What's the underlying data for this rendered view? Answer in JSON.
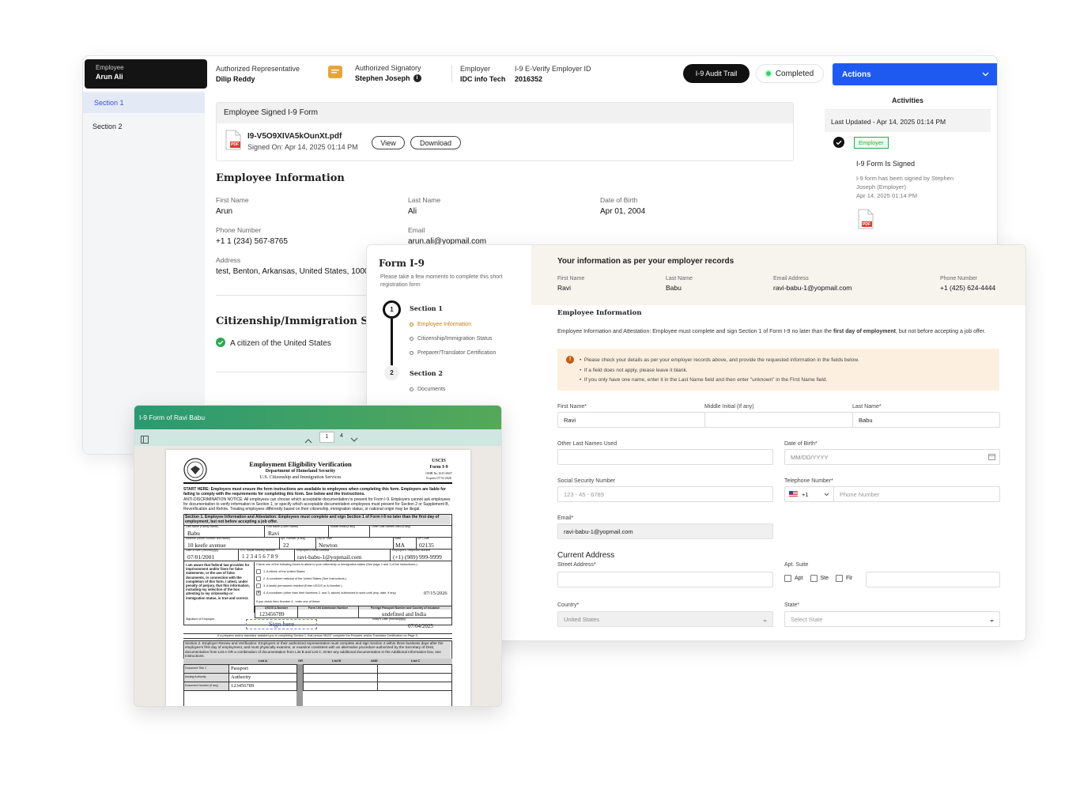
{
  "employee": {
    "label": "Employee",
    "name": "Arun Ali"
  },
  "rep": {
    "label": "Authorized Representative",
    "name": "Dilip Reddy"
  },
  "signatory": {
    "label": "Authorized Signatory",
    "name": "Stephen Joseph"
  },
  "employer": {
    "label": "Employer",
    "name": "IDC info Tech"
  },
  "everify": {
    "label": "I-9 E-Verify Employer ID",
    "value": "2016352"
  },
  "audit_btn": "I-9 Audit Trail",
  "status": "Completed",
  "actions": "Actions",
  "sidebar": {
    "items": [
      "Section 1",
      "Section 2"
    ]
  },
  "signed": {
    "title": "Employee Signed I-9 Form",
    "filename": "I9-V5O9XIVA5kOunXt.pdf",
    "signed_on": "Signed On: Apr 14, 2025 01:14 PM",
    "view": "View",
    "download": "Download",
    "badge": "PDF"
  },
  "emp_info": {
    "title": "Employee Information",
    "first_name_label": "First Name",
    "first_name": "Arun",
    "last_name_label": "Last Name",
    "last_name": "Ali",
    "dob_label": "Date of Birth",
    "dob": "Apr 01, 2004",
    "phone_label": "Phone Number",
    "phone": "+1  1 (234) 567-8765",
    "email_label": "Email",
    "email": "arun.ali@yopmail.com",
    "address_label": "Address",
    "address": "test, Benton, Arkansas, United States, 1000"
  },
  "citizenship": {
    "title": "Citizenship/Immigration Status",
    "value": "A citizen of the United States"
  },
  "activities": {
    "title": "Activities",
    "last_updated": "Last Updated - Apr 14, 2025 01:14 PM",
    "tag": "Employer",
    "event": "I-9 Form Is Signed",
    "desc": "I-9 form has been signed by Stephen Joseph (Employer)",
    "time": "Apr 14, 2025 01:14 PM",
    "badge": "PDF"
  },
  "form": {
    "title": "Form I-9",
    "subtitle": "Please take a few moments to complete this short registration form",
    "steps": [
      {
        "num": "1",
        "title": "Section 1",
        "items": [
          "Employee Information",
          "Citizenship/Immigration Status",
          "Preparer/Translator Certification"
        ]
      },
      {
        "num": "2",
        "title": "Section 2",
        "items": [
          "Documents"
        ]
      }
    ],
    "records_title": "Your information as per your employer records",
    "records": [
      {
        "label": "First Name",
        "value": "Ravi"
      },
      {
        "label": "Last Name",
        "value": "Babu"
      },
      {
        "label": "Email Address",
        "value": "ravi-babu-1@yopmail.com"
      },
      {
        "label": "Phone Number",
        "value": "+1 (425) 624-4444"
      }
    ],
    "section_title": "Employee Information",
    "attest_pre": "Employee Information and Attestation: Employee must complete and sign Section 1 of Form I-9 no later than the ",
    "attest_bold": "first day of employment",
    "attest_post": ", but not before accepting a job offer.",
    "notice": [
      "Please check your details as per your employer records above, and provide the requested information in the fields below.",
      "If a field does not apply, please leave it blank.",
      "If you only have one name, enter it in the Last Name field and then enter \"unknown\" in the First Name field."
    ],
    "first_name_label": "First Name*",
    "first_name": "Ravi",
    "middle_label": "Middle Initial (If any)",
    "middle": "",
    "last_name_label": "Last Name*",
    "last_name": "Babu",
    "other_names_label": "Other Last Names Used",
    "dob_label": "Date of Birth*",
    "dob_placeholder": "MM/DD/YYYY",
    "ssn_label": "Social Security Number",
    "ssn_placeholder": "123 - 45 - 6789",
    "phone_label": "Telephone Number*",
    "phone_code": "+1",
    "phone_placeholder": "Phone Number",
    "email_label": "Email*",
    "email": "ravi-babu-1@yopmail.com",
    "address_title": "Current Address",
    "street_label": "Street Address*",
    "apt_label": "Apt. Suite",
    "apt_options": [
      "Apt",
      "Ste",
      "Flr"
    ],
    "country_label": "Country*",
    "country": "United States",
    "state_label": "State*",
    "state_placeholder": "Select State"
  },
  "pdf": {
    "title": "I-9 Form of Ravi Babu",
    "page": "1",
    "pages": "4",
    "doc": {
      "heading": "Employment Eligibility Verification",
      "dept": "Department of Homeland Security",
      "agency": "U.S. Citizenship and Immigration Services",
      "uscis": "USCIS",
      "form": "Form I-9",
      "omb": "OMB No.1615-0047",
      "expires": "Expires 07/31/2026",
      "start_here": "START HERE: Employers must ensure the form instructions are available to employees when completing this form. Employers are liable for failing to comply with the requirements for completing this form. See below and the Instructions.",
      "anti_disc": "ANTI-DISCRIMINATION NOTICE: All employees can choose which acceptable documentation to present for Form I-9. Employers cannot ask employees for documentation to verify information in Section 1, or specify which acceptable documentation employees must present for Section 2 or Supplement B, Reverification and Rehire. Treating employees differently based on their citizenship, immigration status, or national origin may be illegal.",
      "sec1": "Section 1. Employee Information and Attestation: Employees must complete and sign Section 1 of Form I-9 no later than the first day of employment, but not before accepting a job offer.",
      "last_name_lbl": "Last Name (Family Name)",
      "last_name": "Babu",
      "first_name_lbl": "First Name (Given Name)",
      "first_name": "Ravi",
      "mi_lbl": "Middle Initial (if any)",
      "other_lbl": "Other Last Names Used (if any)",
      "addr_lbl": "Address (Street Number and Name)",
      "addr": "10 keefe avenue",
      "apt_lbl": "Apt. Number (if any)",
      "apt": "22",
      "city_lbl": "City or Town",
      "city": "Newton",
      "state_lbl": "State",
      "state": "MA",
      "zip_lbl": "ZIP Code",
      "zip": "02135",
      "dob_lbl": "Date of Birth (mm/dd/yyyy)",
      "dob": "07/01/2001",
      "ssn_lbl": "U.S. Social Security Number",
      "ssn": "1 2 3 4 5 6 7 8 9",
      "email_lbl": "Employee's Email Address",
      "email": "ravi-babu-1@yopmail.com",
      "tel_lbl": "Employee's Telephone Number",
      "tel": "(+1) (989) 999-9999",
      "aware": "I am aware that federal law provides for imprisonment and/or fines for false statements, or the use of false documents, in connection with the completion of this form. I attest, under penalty of perjury, that this information, including my selection of the box attesting to my citizenship or immigration status, is true and correct.",
      "check_intro": "Check one of the following boxes to attest to your citizenship or immigration status (See page 2 and 3 of the instructions.):",
      "opt1": "1. A citizen of the United States",
      "opt2": "2. A noncitizen national of the United States (See Instructions.)",
      "opt3": "3. A lawful permanent resident (Enter USCIS or A-Number.)",
      "opt4": "4. A noncitizen (other than Item Numbers 2. and 3. above) authorized to work until (exp. date, if any)",
      "opt4_date": "07/15/2026",
      "item4": "If you check Item Number 4., enter one of these:",
      "uscis_lbl": "USCIS A-Number",
      "uscis_val": "123456789",
      "i94_lbl": "Form I-94 Admission Number",
      "passport_lbl": "Foreign Passport Number and Country of Issuance",
      "passport_val": "undefined and India",
      "sig_lbl": "Signature of Employee",
      "sign_here": "Sign here",
      "today_lbl": "Today's Date (mm/dd/yyyy)",
      "today": "07/04/2025",
      "preparer": "If a preparer and/or translator assisted you in completing Section 1, that person MUST complete the Preparer and/or Translator Certification on Page 3.",
      "sec2": "Section 2. Employer Review and Verification: Employers or their authorized representative must complete and sign Section 2 within three business days after the employee's first day of employment, and must physically examine, or examine consistent with an alternative procedure authorized by the Secretary of DHS, documentation from List A OR a combination of documentation from List B and List C. Enter any additional documentation in the Additional Information box; see Instructions.",
      "list_a": "List A",
      "or": "OR",
      "list_b": "List B",
      "and": "AND",
      "list_c": "List C",
      "doc_title_lbl": "Document Title 1",
      "doc_title": "Passport",
      "issuing_lbl": "Issuing Authority",
      "issuing": "Authority",
      "docnum_lbl": "Document Number (if any)",
      "docnum": "123456789"
    }
  },
  "colors": {
    "accent": "#1f5af0",
    "dark": "#141414",
    "green": "#2fa84f",
    "warning": "#fcefdf",
    "pdf_red": "#e23b2e"
  }
}
